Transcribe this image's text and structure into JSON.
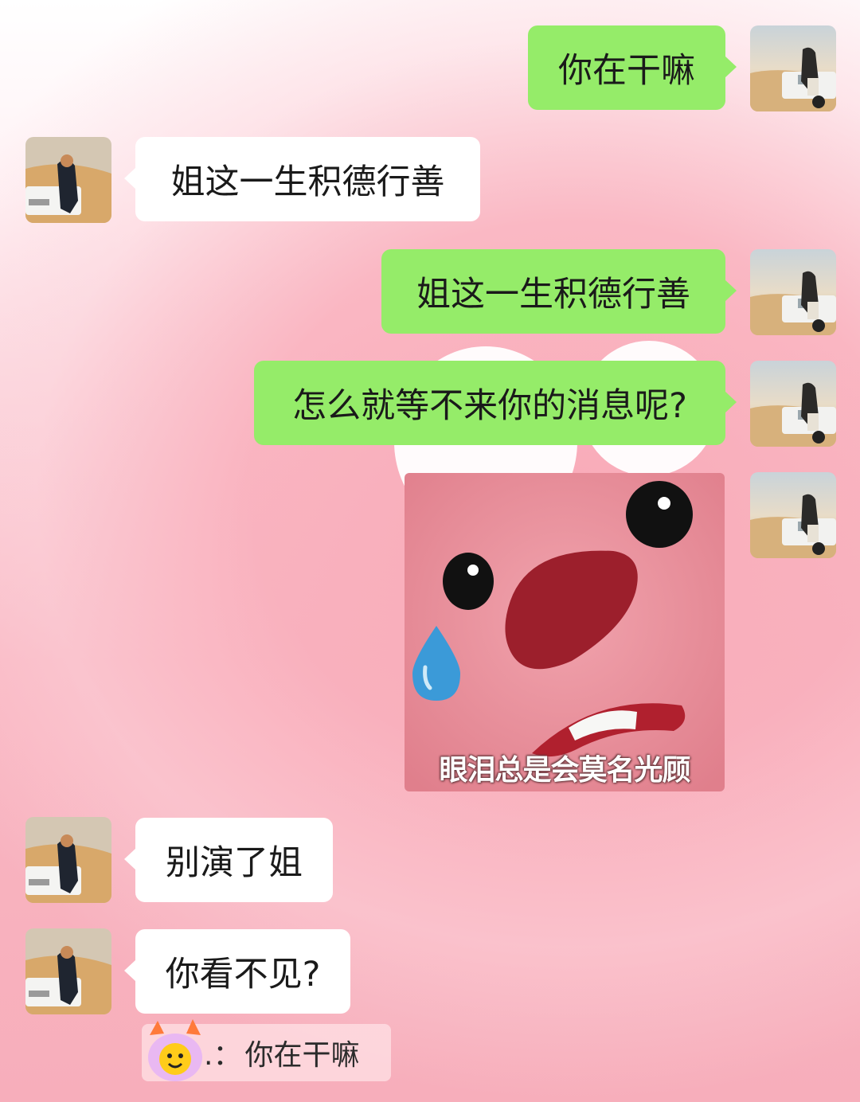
{
  "messages": [
    {
      "direction": "out",
      "type": "text",
      "text": "你在干嘛"
    },
    {
      "direction": "in",
      "type": "text",
      "text": "姐这一生积德行善"
    },
    {
      "direction": "out",
      "type": "text",
      "text": "姐这一生积德行善"
    },
    {
      "direction": "out",
      "type": "text",
      "text": "怎么就等不来你的消息呢?"
    },
    {
      "direction": "out",
      "type": "sticker",
      "caption": "眼泪总是会莫名光顾"
    },
    {
      "direction": "in",
      "type": "text",
      "text": "别演了姐"
    },
    {
      "direction": "in",
      "type": "text",
      "text": "你看不见?"
    }
  ],
  "quote": {
    "author_partial": "…",
    "separator": ".：",
    "text": "你在干嘛"
  },
  "colors": {
    "outgoing_bubble": "#95ec69",
    "incoming_bubble": "#ffffff",
    "background": "#f7aebb"
  },
  "icons": {
    "avatar_self": "avatar-photo-girl-car-desert",
    "avatar_friend": "avatar-photo-boy-car-desert",
    "quote_emoji": "cat-emoji-sticker"
  }
}
